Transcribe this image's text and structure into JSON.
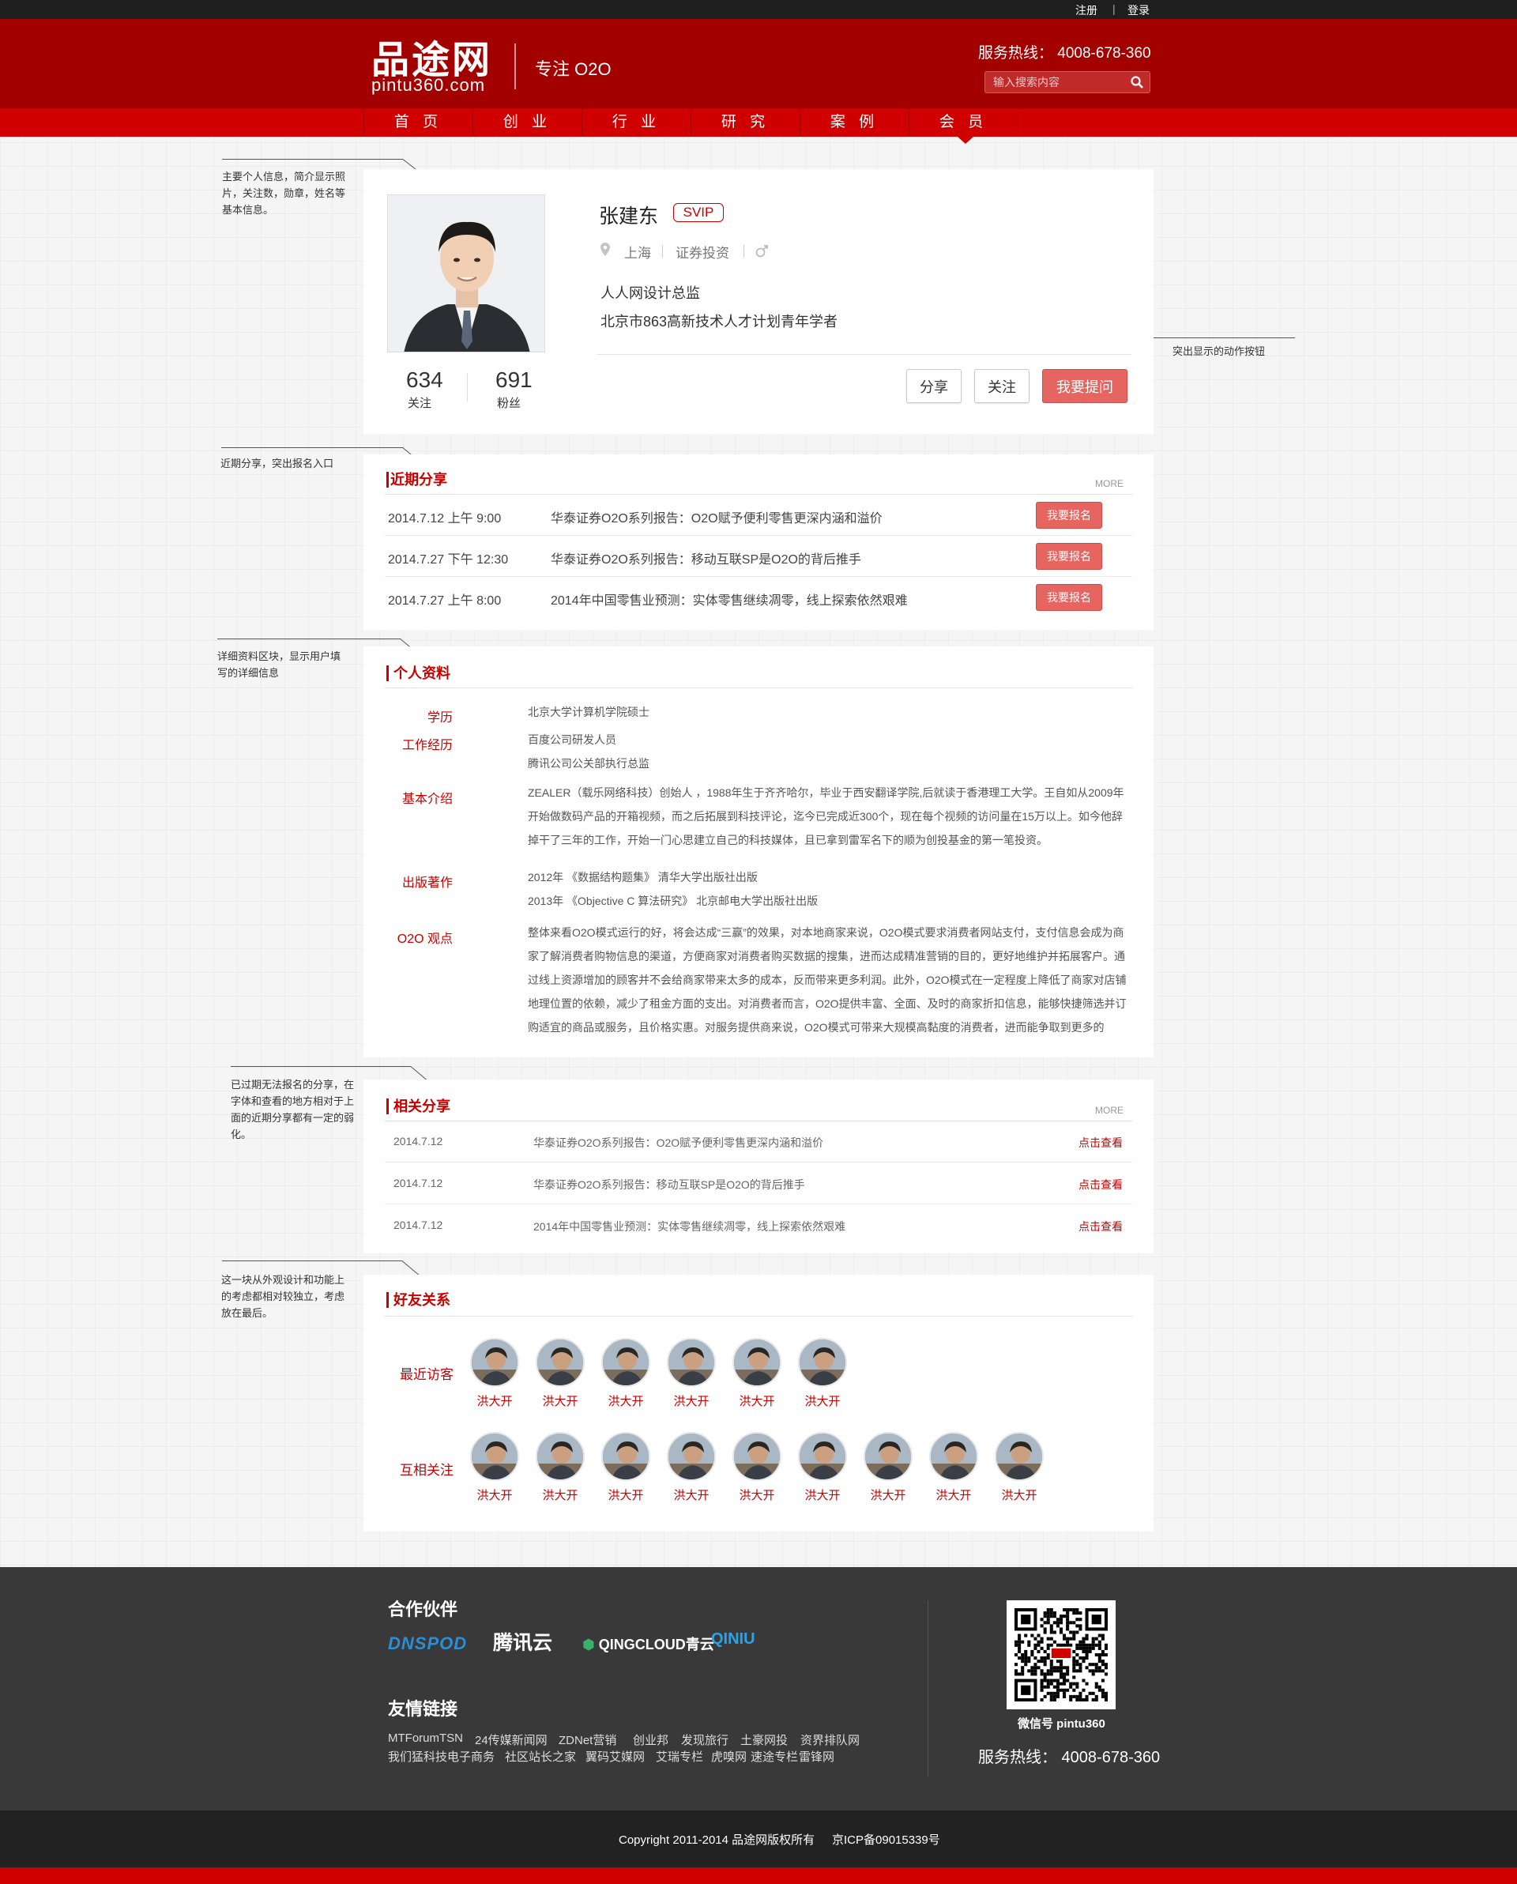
{
  "topbar": {
    "register": "注册",
    "separator": "|",
    "login": "登录"
  },
  "header": {
    "logo_cn": "品途网",
    "logo_en": "pintu360.com",
    "slogan": "专注 O2O",
    "hotline": "服务热线：  4008-678-360",
    "search_placeholder": "输入搜索内容"
  },
  "nav": {
    "items": [
      "首 页",
      "创 业",
      "行 业",
      "研 究",
      "案 例",
      "会 员"
    ],
    "active": "会 员"
  },
  "notes": {
    "profile": "主要个人信息，简介显示照片，关注数，勋章，姓名等基本信息。",
    "actions": "突出显示的动作按钮",
    "recent": "近期分享，突出报名入口",
    "detail": "详细资料区块，显示用户填写的详细信息",
    "related": "已过期无法报名的分享，在字体和查看的地方相对于上面的近期分享都有一定的弱化。",
    "friends": "这一块从外观设计和功能上的考虑都相对较独立，考虑放在最后。"
  },
  "profile": {
    "name": "张建东",
    "badge": "SVIP",
    "city": "上海",
    "industry": "证券投资",
    "gender_icon": "male-icon",
    "bio": [
      "人人网设计总监",
      "北京市863高新技术人才计划青年学者"
    ],
    "follow_count": "634",
    "follow_label": "关注",
    "fans_count": "691",
    "fans_label": "粉丝",
    "share_label": "分享",
    "follow_btn": "关注",
    "ask_label": "我要提问"
  },
  "recent": {
    "title": "近期分享",
    "more": "MORE",
    "signup_label": "我要报名",
    "rows": [
      {
        "date": "2014.7.12  上午 9:00",
        "title": "华泰证券O2O系列报告：O2O赋予便利零售更深内涵和溢价"
      },
      {
        "date": "2014.7.27  下午 12:30",
        "title": "华泰证券O2O系列报告：移动互联SP是O2O的背后推手"
      },
      {
        "date": "2014.7.27  上午 8:00",
        "title": "2014年中国零售业预测：实体零售继续凋零，线上探索依然艰难"
      }
    ]
  },
  "detail": {
    "title": "个人资料",
    "education_label": "学历",
    "education": "北京大学计算机学院硕士",
    "work_label": "工作经历",
    "work": [
      "百度公司研发人员",
      "腾讯公司公关部执行总监"
    ],
    "intro_label": "基本介绍",
    "intro": "ZEALER（载乐网络科技）创始人 ，1988年生于齐齐哈尔，毕业于西安翻译学院,后就读于香港理工大学。王自如从2009年开始做数码产品的开箱视频，而之后拓展到科技评论，迄今已完成近300个，现在每个视频的访问量在15万以上。如今他辞掉干了三年的工作，开始一门心思建立自己的科技媒体，且已拿到雷军名下的顺为创投基金的第一笔投资。",
    "books_label": "出版著作",
    "books": [
      "2012年 《数据结构题集》 清华大学出版社出版",
      "2013年 《Objective C 算法研究》 北京邮电大学出版社出版"
    ],
    "view_label": "O2O 观点",
    "view": "整体来看O2O模式运行的好，将会达成“三赢”的效果，对本地商家来说，O2O模式要求消费者网站支付，支付信息会成为商家了解消费者购物信息的渠道，方便商家对消费者购买数据的搜集，进而达成精准营销的目的，更好地维护并拓展客户。通过线上资源增加的顾客并不会给商家带来太多的成本，反而带来更多利润。此外，O2O模式在一定程度上降低了商家对店铺地理位置的依赖，减少了租金方面的支出。对消费者而言，O2O提供丰富、全面、及时的商家折扣信息，能够快捷筛选并订购适宜的商品或服务，且价格实惠。对服务提供商来说，O2O模式可带来大规模高黏度的消费者，进而能争取到更多的"
  },
  "related": {
    "title": "相关分享",
    "more": "MORE",
    "view_label": "点击查看",
    "rows": [
      {
        "date": "2014.7.12",
        "title": "华泰证券O2O系列报告：O2O赋予便利零售更深内涵和溢价"
      },
      {
        "date": "2014.7.12",
        "title": "华泰证券O2O系列报告：移动互联SP是O2O的背后推手"
      },
      {
        "date": "2014.7.12",
        "title": "2014年中国零售业预测：实体零售继续凋零，线上探索依然艰难"
      }
    ]
  },
  "friends": {
    "title": "好友关系",
    "visitors_label": "最近访客",
    "visitors": [
      "洪大开",
      "洪大开",
      "洪大开",
      "洪大开",
      "洪大开",
      "洪大开"
    ],
    "mutual_label": "互相关注",
    "mutual": [
      "洪大开",
      "洪大开",
      "洪大开",
      "洪大开",
      "洪大开",
      "洪大开",
      "洪大开",
      "洪大开",
      "洪大开"
    ]
  },
  "footer": {
    "partners_title": "合作伙伴",
    "partners": [
      "DNSPOD",
      "腾讯云",
      "QINGCLOUD青云",
      "QINIU"
    ],
    "links_title": "友情链接",
    "links_row1": [
      "MTForumTSN",
      "24传媒新闻网",
      "ZDNet营销",
      "创业邦",
      "发现旅行",
      "土豪网投",
      "资界排队网"
    ],
    "links_row2": [
      "我们猛科技电子商务",
      "社区站长之家",
      "翼码艾媒网",
      "艾瑞专栏",
      "虎嗅网",
      "速途专栏",
      "雷锋网"
    ],
    "wechat": "微信号 pintu360",
    "hotline": "服务热线：  4008-678-360",
    "copyright": "Copyright 2011-2014 品途网版权所有",
    "icp": "京ICP备09015339号"
  },
  "colors": {
    "brand_red": "#a30000",
    "nav_red": "#d10000",
    "accent": "#c80000",
    "button_red": "#e76560"
  }
}
